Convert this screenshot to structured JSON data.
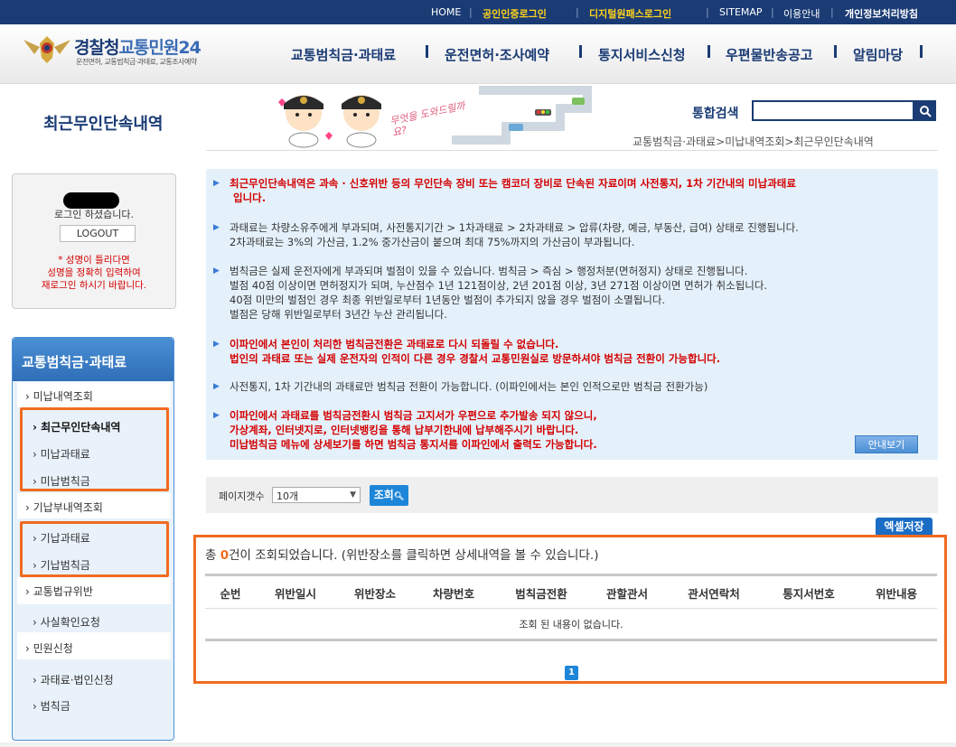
{
  "topbar": {
    "home": "HOME",
    "cert_login": "공인인증로그인",
    "digital_login": "디지털원패스로그인",
    "sitemap": "SITEMAP",
    "guide": "이용안내",
    "privacy": "개인정보처리방침"
  },
  "logo": {
    "title_a": "경찰청",
    "title_b": "교통민원24",
    "subtitle": "운전면허, 교통범칙금·과태료, 교통조사예약"
  },
  "gnb": [
    "교통범칙금·과태료",
    "운전면허·조사예약",
    "통지서비스신청",
    "우편물반송공고",
    "알림마당"
  ],
  "page_title": "최근무인단속내역",
  "banner_text": "무엇을 도와드릴까요?",
  "search": {
    "label": "통합검색",
    "value": ""
  },
  "breadcrumb": "교통범칙금·과태료>미납내역조회>최근무인단속내역",
  "login": {
    "status": "로그인 하셨습니다.",
    "logout": "LOGOUT",
    "warn1": "* 성명이 틀리다면",
    "warn2": "성명을 정확히 입력하여",
    "warn3": "재로그인 하시기 바랍니다."
  },
  "lnb": {
    "title": "교통범칙금·과태료",
    "items": [
      "미납내역조회",
      "최근무인단속내역",
      "미납과태료",
      "미납범칙금",
      "기납부내역조회",
      "기납과태료",
      "기납범칙금",
      "교통법규위반",
      "사실확인요청",
      "민원신청",
      "과태료·법인신청",
      "범칙금"
    ]
  },
  "info": {
    "l1": "최근무인단속내역은 과속 · 신호위반 등의 무인단속 장비 또는 캠코더 장비로 단속된 자료이며 사전통지, 1차 기간내의 미납과태료",
    "l1b": "입니다.",
    "l2": "과태료는 차량소유주에게 부과되며, 사전통지기간 > 1차과태료 > 2차과태료 > 압류(차량, 예금, 부동산, 급여) 상태로 진행됩니다.",
    "l2b": "2차과태료는 3%의 가산금, 1.2% 중가산금이 붙으며 최대 75%까지의 가산금이 부과됩니다.",
    "l3": "범칙금은 실제 운전자에게 부과되며 벌점이 있을 수 있습니다. 범칙금 > 즉심 > 행정처분(면허정지) 상태로 진행됩니다.",
    "l3b": "벌점 40점 이상이면 면허정지가 되며, 누산점수 1년 121점이상, 2년 201점 이상, 3년 271점 이상이면 면허가 취소됩니다.",
    "l3c": "40점 미만의 벌점인 경우 최종 위반일로부터 1년동안 벌점이 추가되지 않을 경우 벌점이 소멸됩니다.",
    "l3d": "벌점은 당해 위반일로부터 3년간 누산 관리됩니다.",
    "l4": "이파인에서 본인이 처리한 범칙금전환은 과태료로 다시 되돌릴 수 없습니다.",
    "l4b": "법인의 과태료 또는 실제 운전자의 인적이 다른 경우 경찰서 교통민원실로 방문하셔야 범칙금 전환이 가능합니다.",
    "l5": "사전통지, 1차 기간내의 과태료만 범칙금 전환이 가능합니다. (이파인에서는 본인 인적으로만 범칙금 전환가능)",
    "l6": "이파인에서 과태료를 범칙금전환시 범칙금 고지서가 우편으로 추가발송 되지 않으니,",
    "l6b": "가상계좌, 인터넷지로, 인터넷뱅킹을 통해 납부기한내에 납부해주시기 바랍니다.",
    "l6c": "미납범칙금 메뉴에 상세보기를 하면 범칙금 통지서를 이파인에서 출력도 가능합니다.",
    "guide_btn": "안내보기"
  },
  "pagesize": {
    "label": "페이지갯수",
    "selected": "10개",
    "button": "조회"
  },
  "excel": "엑셀저장",
  "result": {
    "prefix": "총 ",
    "count": "0",
    "suffix": "건이 조회되었습니다. (위반장소를 클릭하면 상세내역을 볼 수 있습니다.)",
    "columns": [
      "순번",
      "위반일시",
      "위반장소",
      "차량번호",
      "범칙금전환",
      "관할관서",
      "관서연락처",
      "통지서번호",
      "위반내용"
    ],
    "empty": "조회 된 내용이 없습니다.",
    "page": "1"
  },
  "colors": {
    "navy": "#1a3b74",
    "accent_orange": "#f06b20",
    "blue_btn": "#1e86d8",
    "red": "#d40000"
  }
}
